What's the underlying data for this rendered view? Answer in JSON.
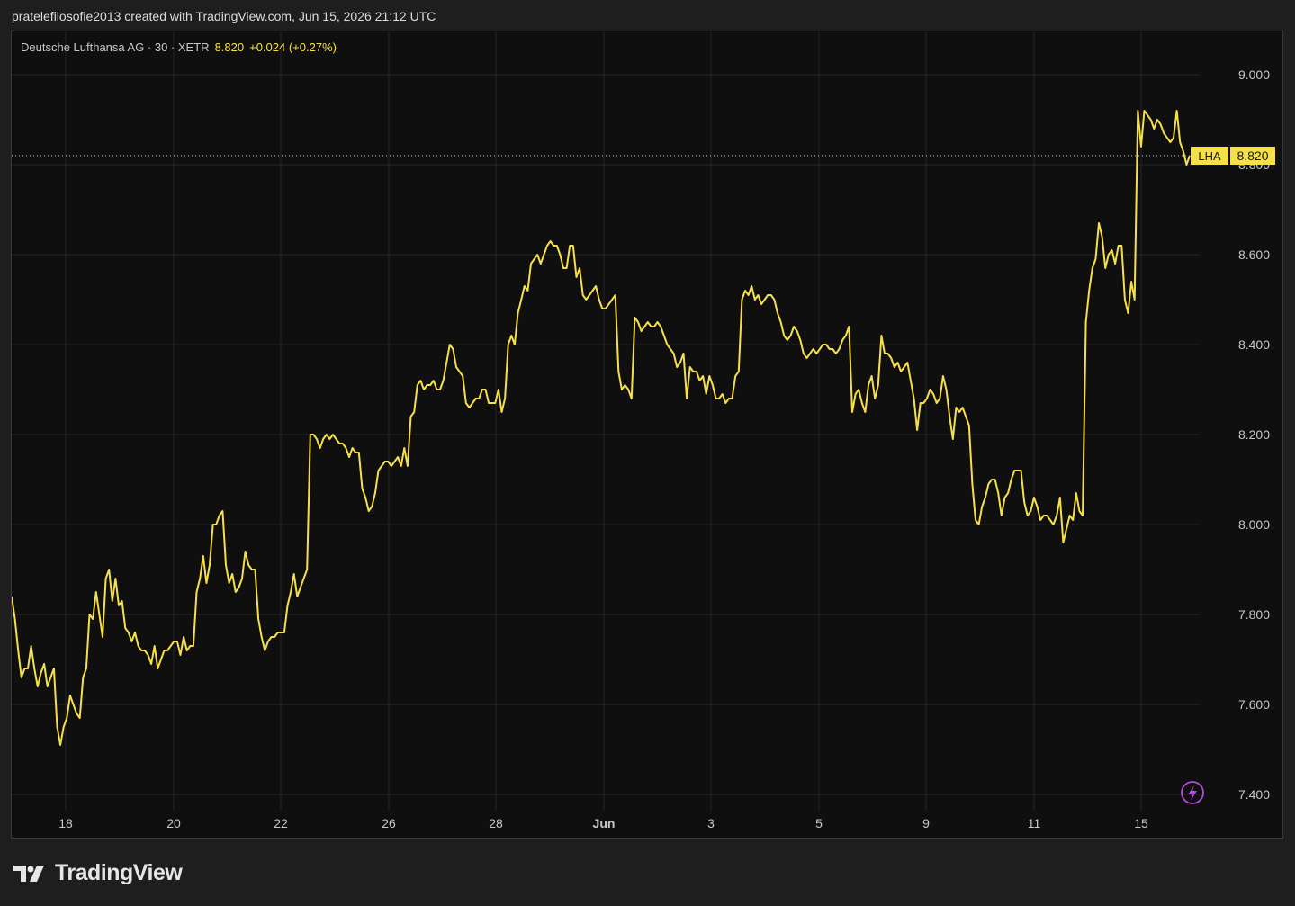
{
  "header": {
    "attribution": "pratelefilosofie2013 created with TradingView.com, Jun 15, 2026 21:12 UTC"
  },
  "legend": {
    "symbol_text": "Deutsche Lufthansa AG · 30 · XETR",
    "price": "8.820",
    "change": "+0.024 (+0.27%)"
  },
  "price_tag": {
    "symbol": "LHA",
    "value": "8.820"
  },
  "logo": {
    "text": "TradingView"
  },
  "colors": {
    "line": "#f6e04a",
    "grid": "#262626",
    "axis_text": "#c8c8c8",
    "background": "#0f0f0f",
    "icon": "#b14ed8"
  },
  "icons": {
    "flash": "lightning-bolt-icon",
    "logo": "tradingview-logo-icon"
  },
  "chart_data": {
    "type": "line",
    "ylim": [
      7.35,
      9.1
    ],
    "y_ticks": [
      9.0,
      8.8,
      8.6,
      8.4,
      8.2,
      8.0,
      7.8,
      7.6,
      7.4
    ],
    "x_tick_labels": [
      "18",
      "20",
      "22",
      "26",
      "28",
      "Jun",
      "3",
      "5",
      "9",
      "11",
      "15"
    ],
    "last_price": 8.82,
    "grid": true,
    "series": [
      {
        "values": [
          7.84,
          7.79,
          7.72,
          7.66,
          7.68,
          7.68,
          7.73,
          7.68,
          7.64,
          7.67,
          7.69,
          7.64,
          7.66,
          7.68,
          7.55,
          7.51,
          7.55,
          7.57,
          7.62,
          7.6,
          7.58,
          7.57,
          7.66,
          7.68,
          7.8,
          7.79,
          7.85,
          7.8,
          7.75,
          7.88,
          7.9,
          7.83,
          7.88,
          7.82,
          7.83,
          7.77,
          7.76,
          7.74,
          7.76,
          7.73,
          7.72,
          7.72,
          7.71,
          7.69,
          7.73,
          7.68,
          7.7,
          7.72,
          7.72,
          7.73,
          7.74,
          7.74,
          7.71,
          7.75,
          7.72,
          7.73,
          7.73,
          7.85,
          7.88,
          7.93,
          7.87,
          7.91,
          8.0,
          8.0,
          8.02,
          8.03,
          7.91,
          7.87,
          7.89,
          7.85,
          7.86,
          7.88,
          7.94,
          7.91,
          7.9,
          7.9,
          7.79,
          7.75,
          7.72,
          7.74,
          7.75,
          7.75,
          7.76,
          7.76,
          7.76,
          7.82,
          7.85,
          7.89,
          7.84,
          7.86,
          7.88,
          7.9,
          8.2,
          8.2,
          8.19,
          8.17,
          8.19,
          8.2,
          8.19,
          8.2,
          8.19,
          8.18,
          8.18,
          8.17,
          8.15,
          8.17,
          8.16,
          8.16,
          8.08,
          8.06,
          8.03,
          8.04,
          8.07,
          8.12,
          8.13,
          8.14,
          8.14,
          8.13,
          8.14,
          8.15,
          8.13,
          8.17,
          8.13,
          8.24,
          8.25,
          8.31,
          8.32,
          8.3,
          8.31,
          8.31,
          8.32,
          8.3,
          8.3,
          8.32,
          8.36,
          8.4,
          8.39,
          8.35,
          8.34,
          8.33,
          8.27,
          8.26,
          8.27,
          8.28,
          8.28,
          8.3,
          8.3,
          8.27,
          8.27,
          8.27,
          8.3,
          8.25,
          8.28,
          8.4,
          8.42,
          8.4,
          8.47,
          8.5,
          8.53,
          8.52,
          8.58,
          8.59,
          8.6,
          8.58,
          8.6,
          8.62,
          8.63,
          8.62,
          8.62,
          8.6,
          8.57,
          8.57,
          8.62,
          8.62,
          8.55,
          8.57,
          8.51,
          8.5,
          8.51,
          8.52,
          8.53,
          8.5,
          8.48,
          8.48,
          8.49,
          8.5,
          8.51,
          8.34,
          8.3,
          8.31,
          8.3,
          8.28,
          8.46,
          8.45,
          8.43,
          8.44,
          8.45,
          8.44,
          8.44,
          8.45,
          8.44,
          8.42,
          8.4,
          8.39,
          8.38,
          8.35,
          8.36,
          8.38,
          8.28,
          8.35,
          8.34,
          8.34,
          8.32,
          8.33,
          8.29,
          8.33,
          8.31,
          8.28,
          8.28,
          8.29,
          8.27,
          8.28,
          8.28,
          8.33,
          8.34,
          8.5,
          8.52,
          8.51,
          8.53,
          8.5,
          8.51,
          8.49,
          8.5,
          8.51,
          8.51,
          8.5,
          8.47,
          8.45,
          8.42,
          8.41,
          8.42,
          8.44,
          8.43,
          8.41,
          8.38,
          8.37,
          8.38,
          8.39,
          8.38,
          8.39,
          8.4,
          8.4,
          8.39,
          8.39,
          8.38,
          8.39,
          8.41,
          8.42,
          8.44,
          8.25,
          8.29,
          8.3,
          8.27,
          8.25,
          8.31,
          8.33,
          8.28,
          8.31,
          8.42,
          8.38,
          8.38,
          8.37,
          8.35,
          8.36,
          8.34,
          8.35,
          8.36,
          8.32,
          8.28,
          8.21,
          8.27,
          8.27,
          8.28,
          8.3,
          8.29,
          8.27,
          8.28,
          8.33,
          8.3,
          8.24,
          8.19,
          8.26,
          8.25,
          8.26,
          8.24,
          8.22,
          8.09,
          8.01,
          8.0,
          8.04,
          8.06,
          8.09,
          8.1,
          8.1,
          8.07,
          8.02,
          8.06,
          8.07,
          8.1,
          8.12,
          8.12,
          8.12,
          8.05,
          8.02,
          8.03,
          8.06,
          8.04,
          8.01,
          8.02,
          8.02,
          8.01,
          8.0,
          8.02,
          8.06,
          7.96,
          7.99,
          8.02,
          8.01,
          8.07,
          8.03,
          8.02,
          8.45,
          8.52,
          8.57,
          8.59,
          8.67,
          8.64,
          8.57,
          8.6,
          8.61,
          8.58,
          8.62,
          8.62,
          8.5,
          8.47,
          8.54,
          8.5,
          8.92,
          8.84,
          8.92,
          8.91,
          8.9,
          8.88,
          8.9,
          8.89,
          8.87,
          8.86,
          8.85,
          8.86,
          8.92,
          8.85,
          8.83,
          8.8,
          8.82
        ]
      }
    ]
  }
}
